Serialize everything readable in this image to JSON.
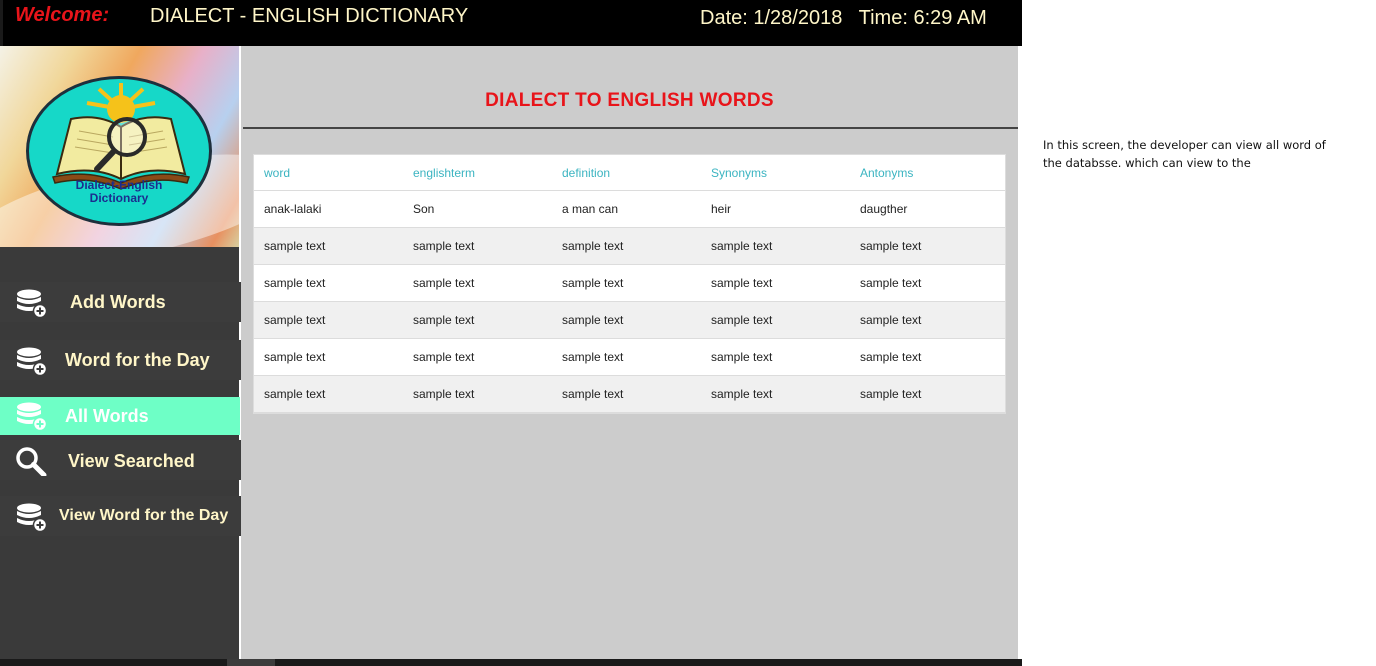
{
  "header": {
    "welcome": "Welcome:",
    "title": "DIALECT - ENGLISH DICTIONARY",
    "datetime": "Date: 1/28/2018   Time: 6:29 AM"
  },
  "logo": {
    "line1": "Dialect-English",
    "line2": "Dictionary"
  },
  "sidebar": {
    "items": [
      {
        "label": "Add Words",
        "icon": "database-add-icon"
      },
      {
        "label": "Word for the Day",
        "icon": "database-add-icon"
      },
      {
        "label": "All Words",
        "icon": "database-add-icon",
        "active": true
      },
      {
        "label": "View Searched",
        "icon": "search-icon"
      },
      {
        "label": "View Word for the Day",
        "icon": "database-add-icon"
      }
    ]
  },
  "main": {
    "title": "DIALECT TO ENGLISH WORDS",
    "table": {
      "columns": [
        "word",
        "englishterm",
        "definition",
        "Synonyms",
        "Antonyms"
      ],
      "rows": [
        [
          "anak-lalaki",
          "Son",
          "a man can",
          "heir",
          "daugther"
        ],
        [
          "sample text",
          "sample text",
          "sample text",
          "sample text",
          "sample text"
        ],
        [
          "sample text",
          "sample text",
          "sample text",
          "sample text",
          "sample text"
        ],
        [
          "sample text",
          "sample text",
          "sample text",
          "sample text",
          "sample text"
        ],
        [
          "sample text",
          "sample text",
          "sample text",
          "sample text",
          "sample text"
        ],
        [
          "sample text",
          "sample text",
          "sample text",
          "sample text",
          "sample text"
        ]
      ]
    }
  },
  "note": {
    "text": "In this screen, the developer can view all word of the databsse. which can view to the"
  },
  "colors": {
    "accent_red": "#e8141a",
    "header_text": "#fff6c8",
    "active_nav": "#6effc6",
    "column_header": "#3bb4c1"
  }
}
